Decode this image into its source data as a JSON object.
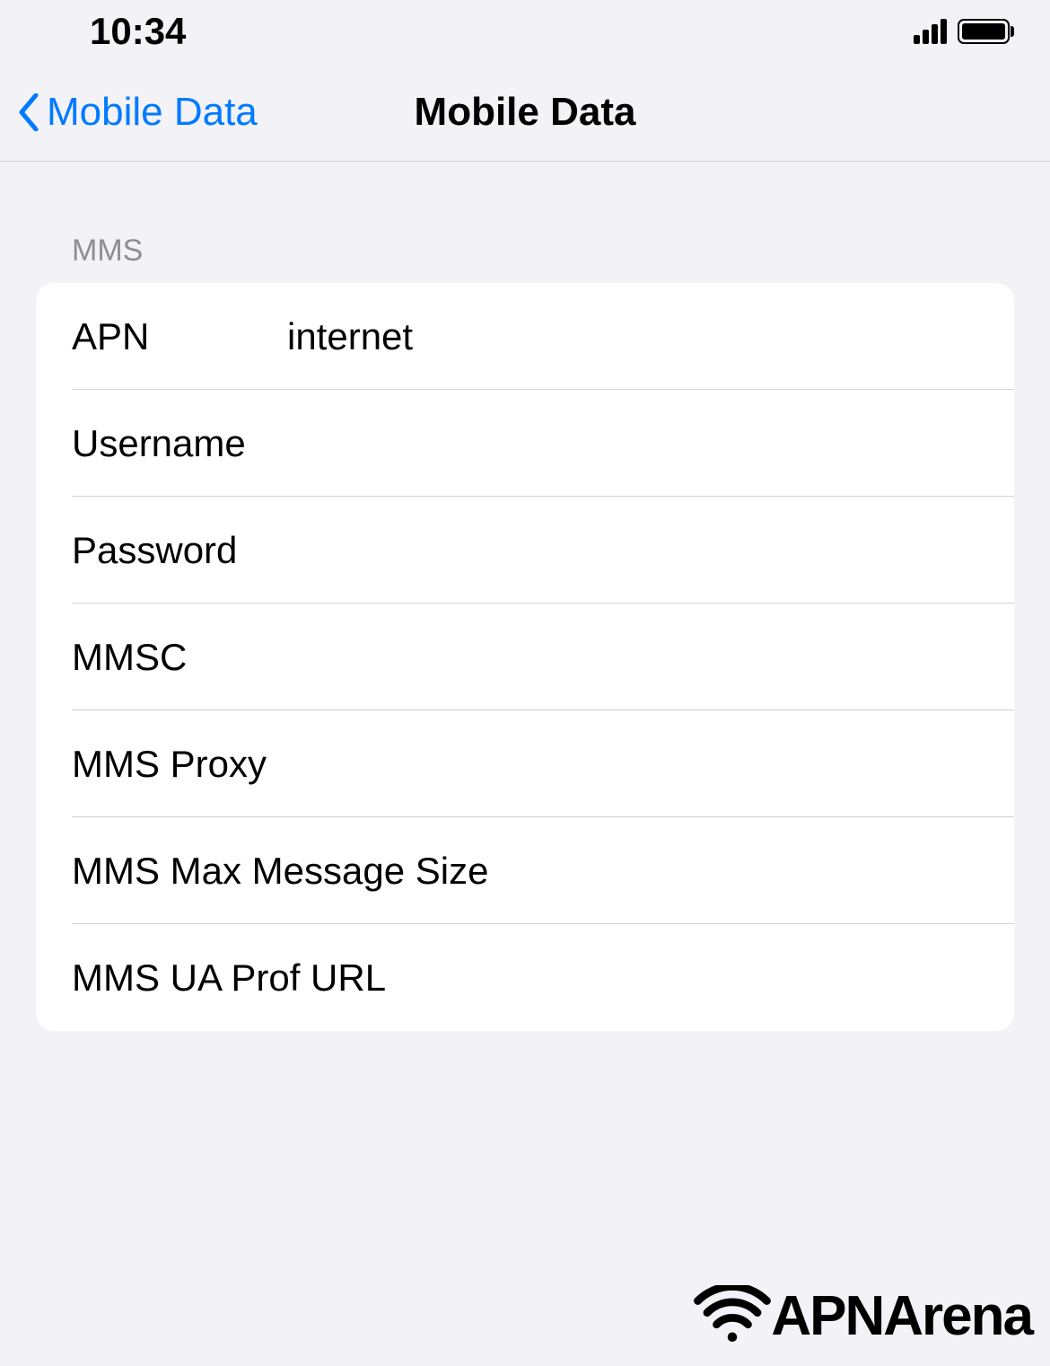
{
  "statusBar": {
    "time": "10:34"
  },
  "navBar": {
    "backLabel": "Mobile Data",
    "title": "Mobile Data"
  },
  "section": {
    "header": "MMS",
    "rows": [
      {
        "label": "APN",
        "value": "internet"
      },
      {
        "label": "Username",
        "value": ""
      },
      {
        "label": "Password",
        "value": ""
      },
      {
        "label": "MMSC",
        "value": ""
      },
      {
        "label": "MMS Proxy",
        "value": ""
      },
      {
        "label": "MMS Max Message Size",
        "value": ""
      },
      {
        "label": "MMS UA Prof URL",
        "value": ""
      }
    ]
  },
  "watermark": {
    "text": "APNArena"
  },
  "footer": {
    "text": "APNArena"
  }
}
